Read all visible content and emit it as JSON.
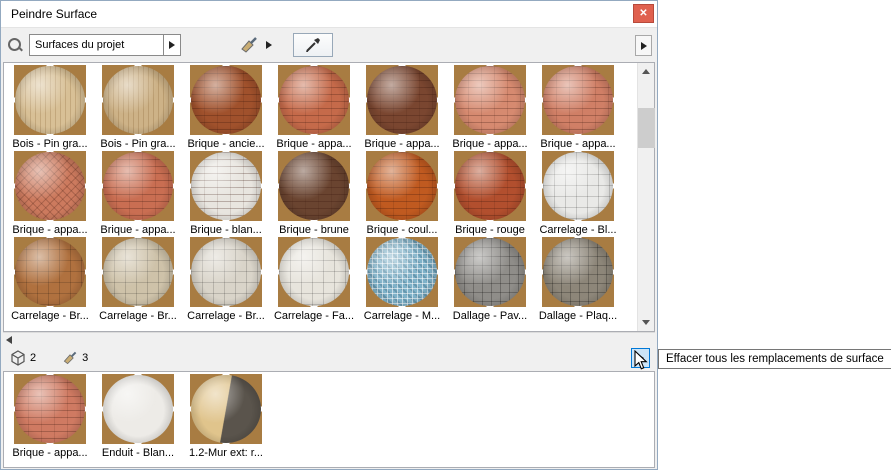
{
  "window": {
    "title": "Peindre Surface"
  },
  "icons": {
    "close": "✕"
  },
  "colors": {
    "hover-bg": "#cce4f7",
    "hover-border": "#0078d7",
    "close-bg": "#e0614f",
    "tile-corner": "#a87c42"
  },
  "toolbar": {
    "search_value": "Surfaces du projet"
  },
  "status": {
    "model_count": "2",
    "override_count": "3"
  },
  "tooltip": {
    "text": "Effacer tous les remplacements de surface"
  },
  "catalog": {
    "items": [
      {
        "label": "Bois - Pin gra...",
        "color": "#d8c096",
        "pattern": "wood"
      },
      {
        "label": "Bois - Pin gra...",
        "color": "#cdb287",
        "pattern": "wood"
      },
      {
        "label": "Brique - ancie...",
        "color": "#a0512c",
        "pattern": "brick"
      },
      {
        "label": "Brique - appa...",
        "color": "#c56a4a",
        "pattern": "brick"
      },
      {
        "label": "Brique - appa...",
        "color": "#7a4630",
        "pattern": "brick"
      },
      {
        "label": "Brique - appa...",
        "color": "#d68a70",
        "pattern": "brick"
      },
      {
        "label": "Brique - appa...",
        "color": "#d07f66",
        "pattern": "brick"
      },
      {
        "label": "Brique - appa...",
        "color": "#cc7a5e",
        "pattern": "herringbone"
      },
      {
        "label": "Brique - appa...",
        "color": "#c96e52",
        "pattern": "brick"
      },
      {
        "label": "Brique - blan...",
        "color": "#e8e5df",
        "pattern": "brick"
      },
      {
        "label": "Brique - brune",
        "color": "#6a4430",
        "pattern": "brick"
      },
      {
        "label": "Brique - coul...",
        "color": "#c05a20",
        "pattern": "brick"
      },
      {
        "label": "Brique - rouge",
        "color": "#b24f2e",
        "pattern": "brick"
      },
      {
        "label": "Carrelage - Bl...",
        "color": "#e9e9e7",
        "pattern": "tile"
      },
      {
        "label": "Carrelage - Br...",
        "color": "#b0713f",
        "pattern": "tile"
      },
      {
        "label": "Carrelage - Br...",
        "color": "#cec2a9",
        "pattern": "tile"
      },
      {
        "label": "Carrelage - Br...",
        "color": "#d9d4c9",
        "pattern": "tile"
      },
      {
        "label": "Carrelage - Fa...",
        "color": "#e7e4dc",
        "pattern": "tile"
      },
      {
        "label": "Carrelage - M...",
        "color": "#7fb2c9",
        "pattern": "mosaic"
      },
      {
        "label": "Dallage - Pav...",
        "color": "#8f8d89",
        "pattern": "stone"
      },
      {
        "label": "Dallage - Plaq...",
        "color": "#8d8679",
        "pattern": "stone"
      }
    ]
  },
  "overrides": {
    "items": [
      {
        "label": "Brique - appa...",
        "color": "#cf7a62",
        "pattern": "brick"
      },
      {
        "label": "Enduit - Blan...",
        "color": "#edebe7",
        "pattern": "plain"
      },
      {
        "label": "1.2-Mur ext: r...",
        "color": "#e0c48c",
        "color2": "#5a544c",
        "pattern": "split"
      }
    ]
  }
}
